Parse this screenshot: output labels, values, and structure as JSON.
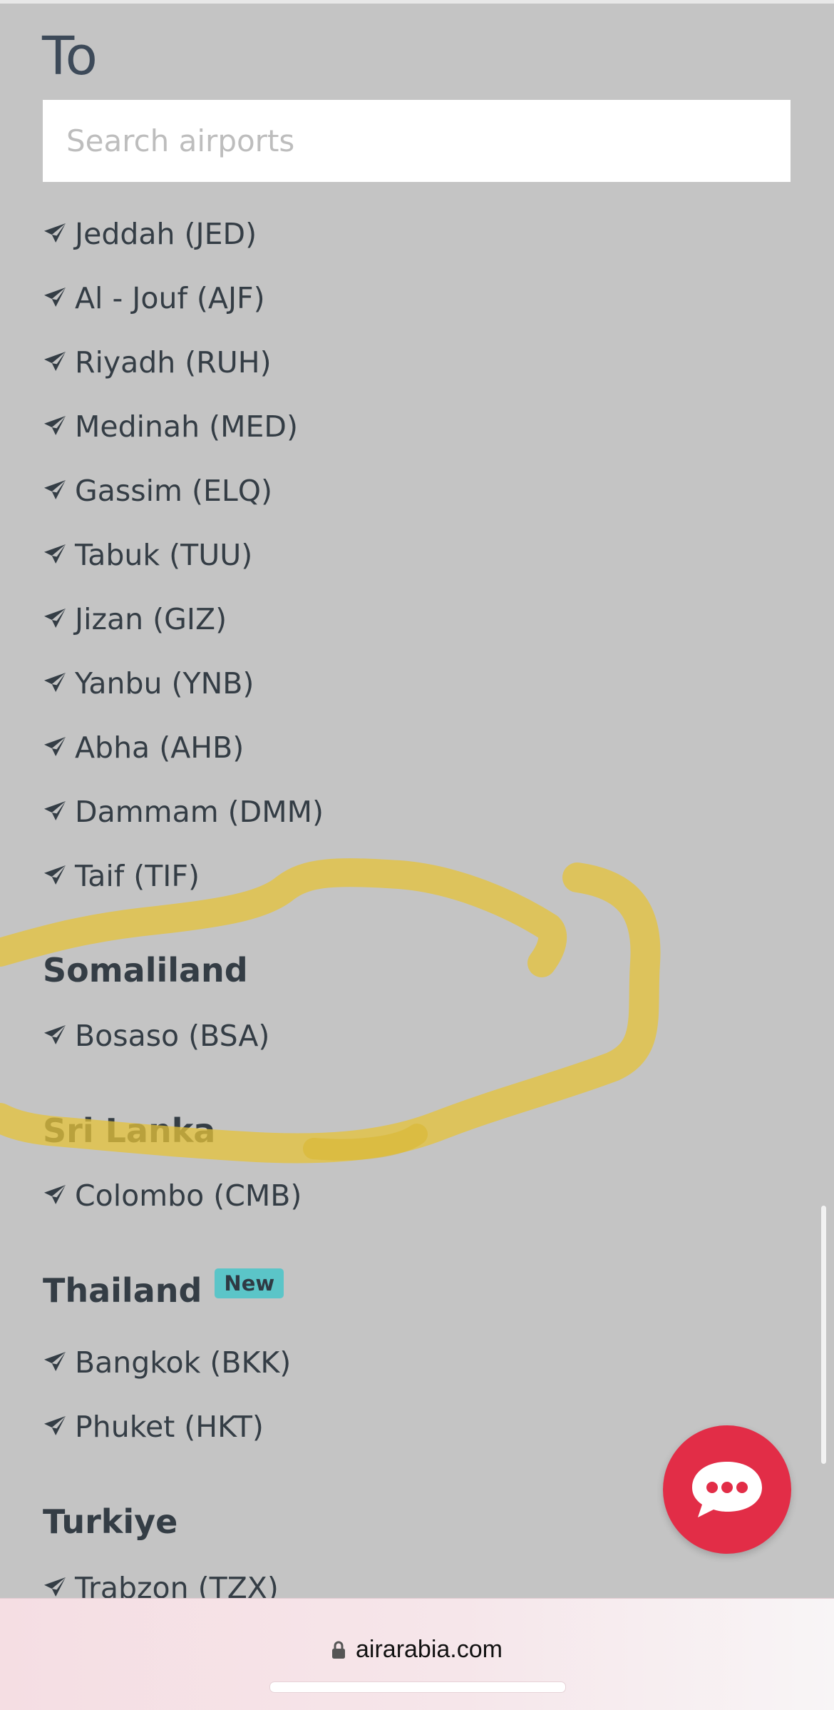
{
  "modal": {
    "heading": "To",
    "search": {
      "placeholder": "Search airports",
      "value": ""
    }
  },
  "groups": [
    {
      "country": "",
      "airports": [
        "Jeddah (JED)",
        "Al - Jouf (AJF)",
        "Riyadh (RUH)",
        "Medinah (MED)",
        "Gassim (ELQ)",
        "Tabuk (TUU)",
        "Jizan (GIZ)",
        "Yanbu (YNB)",
        "Abha (AHB)",
        "Dammam (DMM)",
        "Taif (TIF)"
      ]
    },
    {
      "country": "Somaliland",
      "airports": [
        "Bosaso (BSA)"
      ]
    },
    {
      "country": "Sri Lanka",
      "airports": [
        "Colombo (CMB)"
      ]
    },
    {
      "country": "Thailand",
      "badge": "New",
      "airports": [
        "Bangkok (BKK)",
        "Phuket (HKT)"
      ]
    },
    {
      "country": "Turkiye",
      "airports": [
        "Trabzon (TZX)"
      ]
    }
  ],
  "icons": {
    "airport": "plane-icon",
    "chat": "chat-bubble-icon",
    "lock": "lock-icon"
  },
  "colors": {
    "chat_button": "#e22d47",
    "badge": "#5bc5c8",
    "highlight": "#e5c33a"
  },
  "browser": {
    "url": "airarabia.com"
  }
}
